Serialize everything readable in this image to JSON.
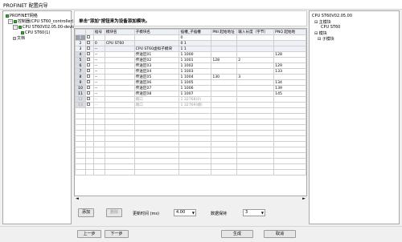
{
  "window": {
    "title": "PROFINET 配置向导"
  },
  "tree": {
    "root": "PROFINET网络",
    "controller": "控制器(CPU ST60_controller)",
    "device": "CPU ST60V02.05.00-device",
    "device_child": "CPU ST60(1)",
    "archive": "文档"
  },
  "header": {
    "hint": "单击\"添加\"按钮来为设备添加模块。"
  },
  "table": {
    "columns": [
      "",
      "",
      "插号",
      "模块名",
      "子模块名",
      "插槽_子插槽",
      "PNI 起始地址",
      "输入长度（字节）",
      "PNQ 起始地"
    ],
    "rows": [
      {
        "num": "1",
        "slot": "",
        "module": "",
        "submodule": "",
        "slotsub": "0",
        "pni": "",
        "inlen": "",
        "pnq": "",
        "style": "sel"
      },
      {
        "num": "2",
        "slot": "0",
        "module": "CPU ST60",
        "submodule": "",
        "slotsub": "0 1",
        "pni": "",
        "inlen": "",
        "pnq": "",
        "style": "sub"
      },
      {
        "num": "3",
        "slot": "--",
        "module": "",
        "submodule": "CPU ST60虚拟子模块",
        "slotsub": "1 1",
        "pni": "",
        "inlen": "",
        "pnq": "",
        "style": "sub"
      },
      {
        "num": "4",
        "slot": "--",
        "module": "",
        "submodule": "传送区01",
        "slotsub": "1 1000",
        "pni": "",
        "inlen": "",
        "pnq": "128",
        "style": ""
      },
      {
        "num": "5",
        "slot": "--",
        "module": "",
        "submodule": "传送区02",
        "slotsub": "1 1001",
        "pni": "128",
        "inlen": "2",
        "pnq": "",
        "style": ""
      },
      {
        "num": "6",
        "slot": "--",
        "module": "",
        "submodule": "传送区03",
        "slotsub": "1 1002",
        "pni": "",
        "inlen": "",
        "pnq": "129",
        "style": ""
      },
      {
        "num": "7",
        "slot": "--",
        "module": "",
        "submodule": "传送区04",
        "slotsub": "1 1003",
        "pni": "",
        "inlen": "",
        "pnq": "133",
        "style": ""
      },
      {
        "num": "8",
        "slot": "--",
        "module": "",
        "submodule": "传送区05",
        "slotsub": "1 1004",
        "pni": "130",
        "inlen": "3",
        "pnq": "",
        "style": ""
      },
      {
        "num": "9",
        "slot": "--",
        "module": "",
        "submodule": "传送区06",
        "slotsub": "1 1005",
        "pni": "",
        "inlen": "",
        "pnq": "134",
        "style": ""
      },
      {
        "num": "10",
        "slot": "--",
        "module": "",
        "submodule": "传送区07",
        "slotsub": "1 1006",
        "pni": "",
        "inlen": "",
        "pnq": "139",
        "style": ""
      },
      {
        "num": "11",
        "slot": "--",
        "module": "",
        "submodule": "传送区08",
        "slotsub": "1 1007",
        "pni": "",
        "inlen": "",
        "pnq": "145",
        "style": ""
      },
      {
        "num": "12",
        "slot": "--",
        "module": "",
        "submodule": "端口",
        "slotsub": "1 32768(0)",
        "pni": "",
        "inlen": "",
        "pnq": "",
        "style": "disabled"
      },
      {
        "num": "13",
        "slot": "--",
        "module": "",
        "submodule": "端口",
        "slotsub": "1 32769(端)",
        "pni": "",
        "inlen": "",
        "pnq": "",
        "style": "disabled"
      }
    ]
  },
  "controls": {
    "add": "添加",
    "delete": "删除",
    "update_time_label": "更新时间 (ms)",
    "update_time_value": "4.00",
    "watchdog_label": "数据保持",
    "watchdog_value": "3"
  },
  "rightpane": {
    "title": "CPU ST60V02.05.00",
    "main_module": "主模块",
    "cpu": "CPU ST60",
    "module": "模块",
    "submodule": "子模块"
  },
  "footer": {
    "prev": "上一步",
    "next": "下一步",
    "generate": "生成",
    "cancel": "取消"
  }
}
